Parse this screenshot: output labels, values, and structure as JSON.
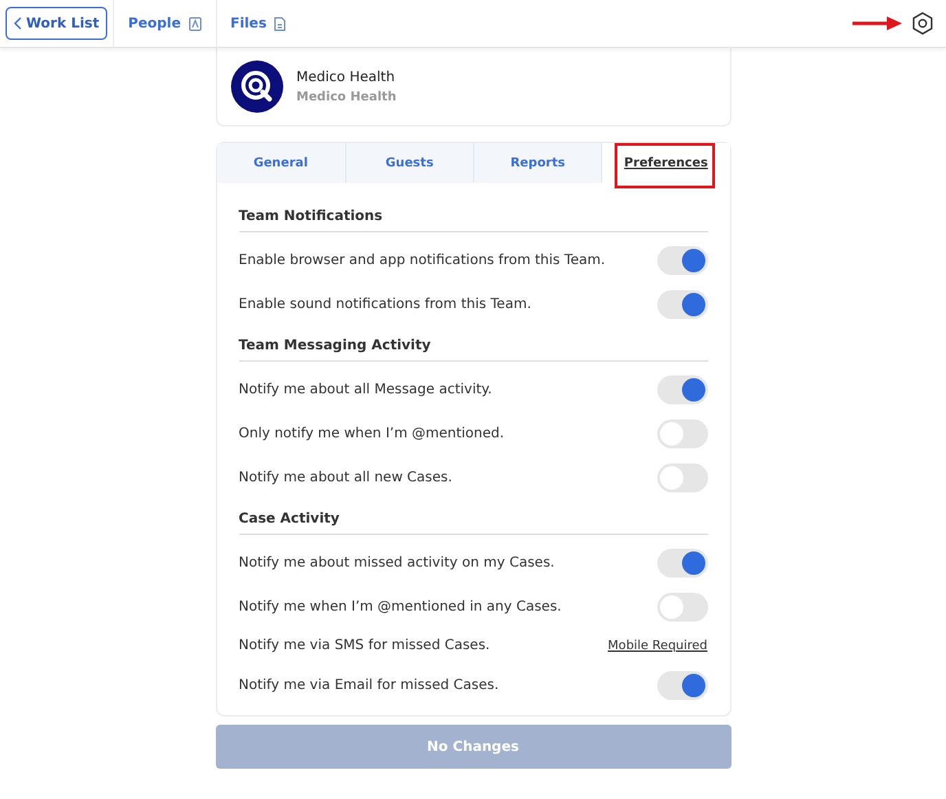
{
  "nav": {
    "back": {
      "label": "Work List"
    },
    "links": [
      {
        "label": "People",
        "selected": false
      },
      {
        "label": "Files",
        "selected": false
      }
    ],
    "settings_button": {
      "pointed_at": true
    }
  },
  "team": {
    "name": "Medico Health",
    "subtitle": "Medico Health"
  },
  "tabs": [
    {
      "label": "General",
      "selected": false,
      "highlighted": false
    },
    {
      "label": "Guests",
      "selected": false,
      "highlighted": false
    },
    {
      "label": "Reports",
      "selected": false,
      "highlighted": false
    },
    {
      "label": "Preferences",
      "selected": true,
      "highlighted": true
    }
  ],
  "sections": [
    {
      "title": "Team Notifications",
      "rows": [
        {
          "kind": "toggle",
          "label": "Enable browser and app notifications from this Team.",
          "on": true
        },
        {
          "kind": "toggle",
          "label": "Enable sound notifications from this Team.",
          "on": true
        }
      ]
    },
    {
      "title": "Team Messaging Activity",
      "rows": [
        {
          "kind": "toggle",
          "label": "Notify me about all Message activity.",
          "on": true
        },
        {
          "kind": "toggle",
          "label": "Only notify me when I’m @mentioned.",
          "on": false
        },
        {
          "kind": "toggle",
          "label": "Notify me about all new Cases.",
          "on": false
        }
      ]
    },
    {
      "title": "Case Activity",
      "rows": [
        {
          "kind": "toggle",
          "label": "Notify me about missed activity on my Cases.",
          "on": true
        },
        {
          "kind": "toggle",
          "label": "Notify me when I’m @mentioned in any Cases.",
          "on": false
        },
        {
          "kind": "link",
          "label": "Notify me via SMS for missed Cases.",
          "link": "Mobile Required"
        },
        {
          "kind": "toggle",
          "label": "Notify me via Email for missed Cases.",
          "on": true
        }
      ]
    }
  ],
  "save_button": {
    "label": "No Changes",
    "disabled": true
  }
}
